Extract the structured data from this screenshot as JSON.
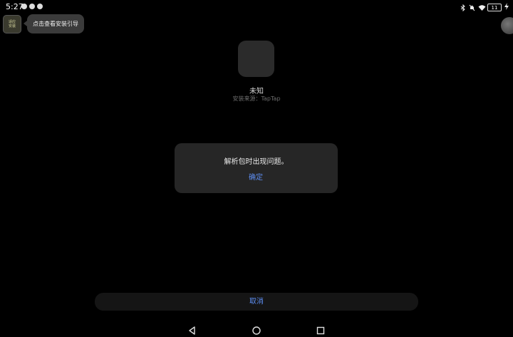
{
  "status_bar": {
    "time": "5:27",
    "battery_level": "11"
  },
  "helper": {
    "app_label_line1": "适应",
    "app_label_line2": "安装",
    "tooltip": "点击查看安装引导"
  },
  "app": {
    "name": "未知",
    "source": "安装来源：TapTap"
  },
  "dialog": {
    "message": "解析包时出现问题。",
    "confirm_label": "确定"
  },
  "cancel_label": "取消",
  "colors": {
    "accent": "#5d8df0",
    "background": "#000000",
    "dialog_bg": "#262626"
  },
  "icons": {
    "nav_back": "back-triangle-icon",
    "nav_home": "home-circle-icon",
    "nav_recent": "recent-square-icon"
  }
}
